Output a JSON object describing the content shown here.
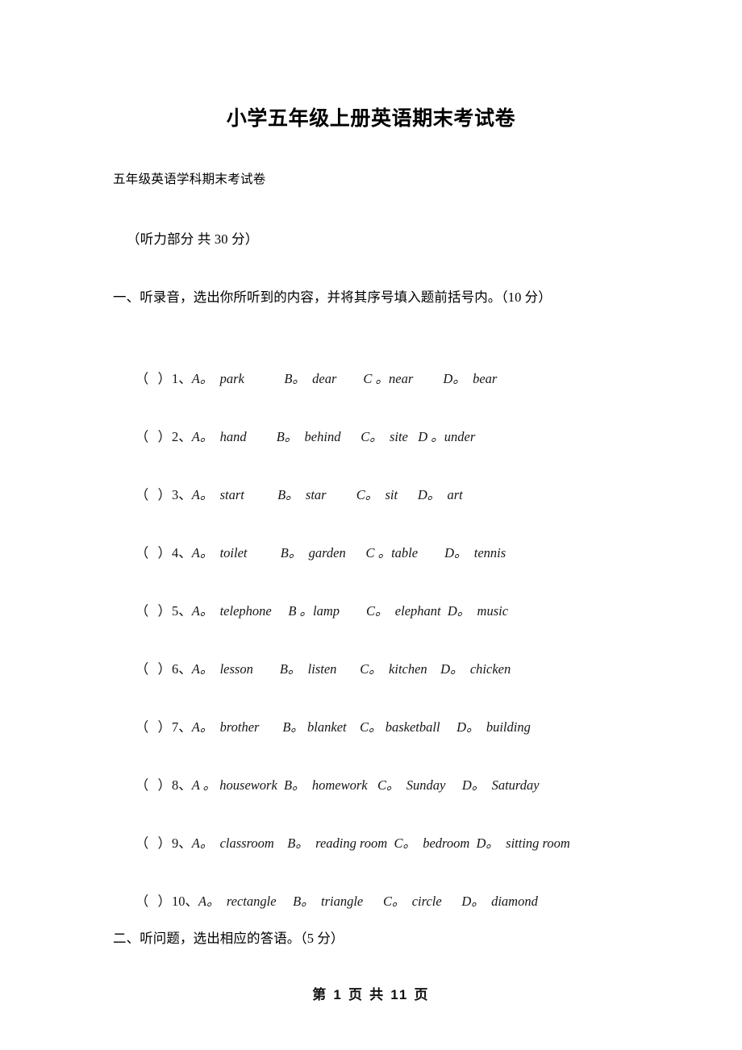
{
  "document": {
    "title": "小学五年级上册英语期末考试卷",
    "subtitle": "五年级英语学科期末考试卷",
    "section_banner": "（听力部分 共 30 分）"
  },
  "sections": [
    {
      "number": "一、",
      "instruction": "一、听录音，选出你所听到的内容，并将其序号填入题前括号内。（10 分）"
    },
    {
      "number": "二、",
      "instruction": "二、听问题，选出相应的答语。（5 分）"
    }
  ],
  "questions": [
    {
      "bracket": "（  ）",
      "number": "1、",
      "options": "A。  park            B。  dear        C 。near         D。  bear"
    },
    {
      "bracket": "（  ）",
      "number": "2、",
      "options": "A。  hand         B。  behind      C。  site   D 。under"
    },
    {
      "bracket": "（  ）",
      "number": "3、",
      "options": "A。  start          B。  star         C。  sit      D。  art"
    },
    {
      "bracket": "（  ）",
      "number": "4、",
      "options": "A。  toilet          B。  garden      C 。table        D。  tennis"
    },
    {
      "bracket": "（  ）",
      "number": "5、",
      "options": "A。  telephone     B 。lamp        C。  elephant  D。  music"
    },
    {
      "bracket": "（  ）",
      "number": "6、",
      "options": "A。  lesson        B。  listen       C。  kitchen    D。  chicken"
    },
    {
      "bracket": "（  ）",
      "number": "7、",
      "options": "A。  brother       B。 blanket    C。 basketball     D。  building"
    },
    {
      "bracket": "（  ）",
      "number": "8、",
      "options": "A 。 housework  B。  homework   C。  Sunday     D。  Saturday"
    },
    {
      "bracket": "（  ）",
      "number": "9、",
      "options": "A。  classroom    B。  reading room  C。  bedroom  D。  sitting room"
    },
    {
      "bracket": "（  ）",
      "number": "10、",
      "options": "A。  rectangle     B。  triangle      C。  circle      D。  diamond"
    }
  ],
  "footer": {
    "page_label": "第 1 页 共 11 页"
  }
}
